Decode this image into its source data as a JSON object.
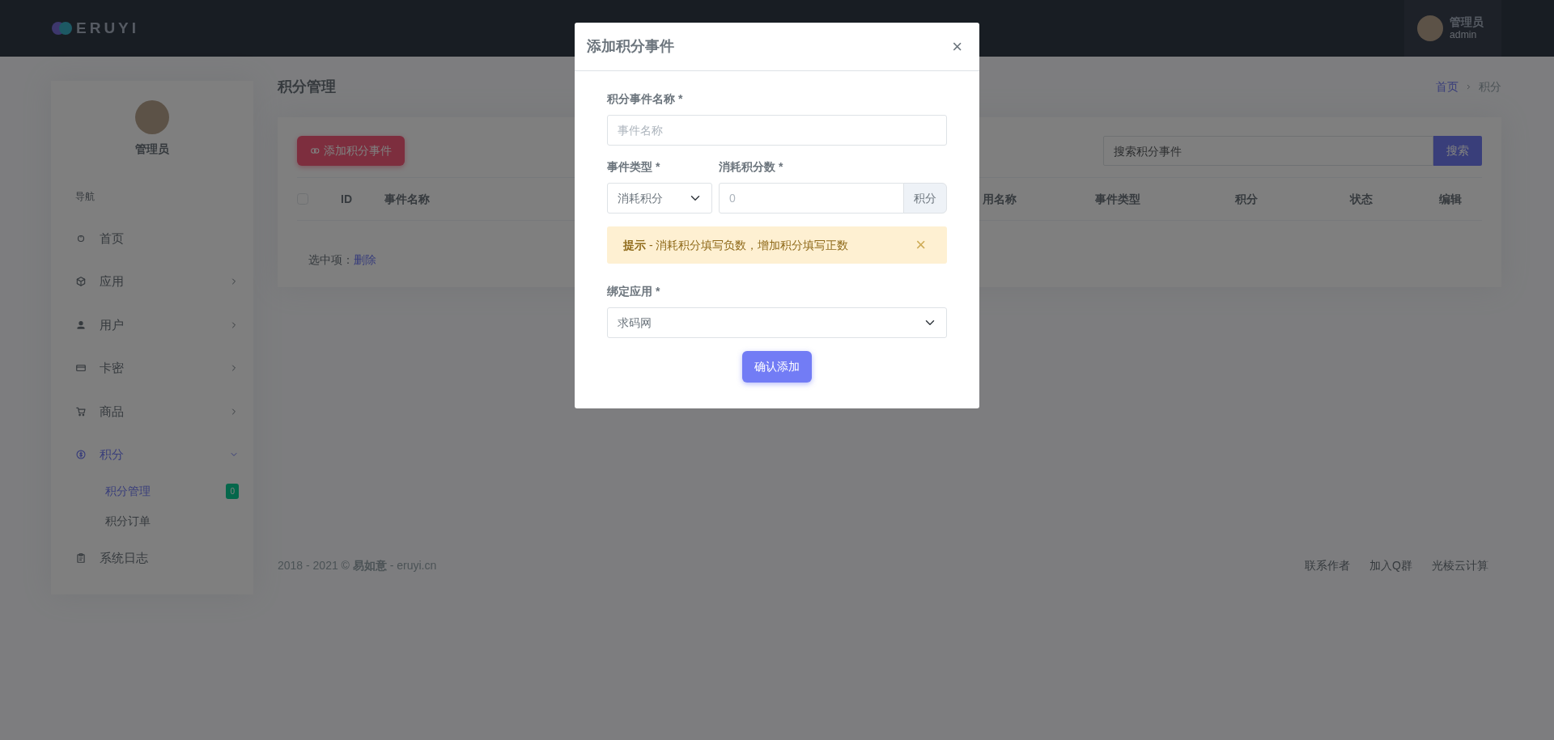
{
  "topbar": {
    "logo": "ERUYI",
    "user": {
      "name": "管理员",
      "role": "admin"
    }
  },
  "sidebar": {
    "profile_name": "管理员",
    "section_label": "导航",
    "items": [
      {
        "label": "首页",
        "kind": "link",
        "selected": false
      },
      {
        "label": "应用",
        "kind": "menu",
        "selected": false,
        "expanded": false
      },
      {
        "label": "用户",
        "kind": "menu",
        "selected": false,
        "expanded": false
      },
      {
        "label": "卡密",
        "kind": "menu",
        "selected": false,
        "expanded": false
      },
      {
        "label": "商品",
        "kind": "menu",
        "selected": false,
        "expanded": false
      },
      {
        "label": "积分",
        "kind": "menu",
        "selected": true,
        "expanded": true,
        "children": [
          {
            "label": "积分管理",
            "selected": true,
            "badge": "0"
          },
          {
            "label": "积分订单",
            "selected": false
          }
        ]
      },
      {
        "label": "系统日志",
        "kind": "link",
        "selected": false
      }
    ]
  },
  "page": {
    "title": "积分管理",
    "breadcrumb": [
      {
        "label": "首页",
        "current": false
      },
      {
        "label": "积分",
        "current": true
      }
    ]
  },
  "toolbar": {
    "add_button": "添加积分事件",
    "search": {
      "placeholder": "搜索积分事件"
    },
    "search_button": "搜索"
  },
  "table": {
    "select_all": {
      "checked": false
    },
    "columns": [
      "ID",
      "事件名称",
      "用名称",
      "事件类型",
      "积分",
      "状态",
      "编辑"
    ]
  },
  "selection": {
    "label": "选中项：",
    "action": "删除"
  },
  "footer": {
    "copyright": "2018 - 2021 © **易如意** - eruyi.cn",
    "links": [
      "联系作者",
      "加入Q群",
      "光棱云计算"
    ]
  },
  "modal": {
    "title": "添加积分事件",
    "close": "×",
    "name_field": {
      "label": "积分事件名称 *",
      "placeholder": "事件名称"
    },
    "type_field": {
      "label": "事件类型 *",
      "value": "消耗积分"
    },
    "points_field": {
      "label": "消耗积分数 *",
      "placeholder": "0",
      "addon": "积分"
    },
    "alert": {
      "text": "**提示** - 消耗积分填写负数，增加积分填写正数",
      "close": "×"
    },
    "app_field": {
      "label": "绑定应用 *",
      "value": "求码网"
    },
    "submit": "确认添加"
  }
}
